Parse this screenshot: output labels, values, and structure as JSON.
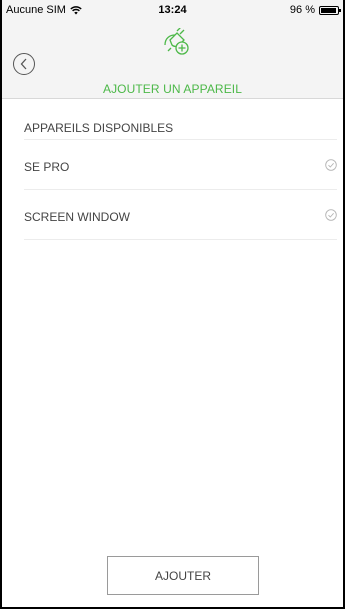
{
  "status_bar": {
    "carrier": "Aucune SIM",
    "time": "13:24",
    "battery_percent": "96 %",
    "battery_level": 0.96
  },
  "nav": {
    "back_icon": "chevron-left-circle-icon",
    "header_icon": "plug-add-icon",
    "title": "AJOUTER UN APPAREIL"
  },
  "devices_section": {
    "header": "APPAREILS DISPONIBLES",
    "items": [
      {
        "label": "SE PRO",
        "icon": "check-circle-icon"
      },
      {
        "label": "SCREEN WINDOW",
        "icon": "check-circle-icon"
      }
    ]
  },
  "actions": {
    "add_label": "AJOUTER"
  },
  "colors": {
    "accent": "#4cb848",
    "bar_background": "#f4f4f4",
    "text": "#444444",
    "divider": "#ececec"
  }
}
